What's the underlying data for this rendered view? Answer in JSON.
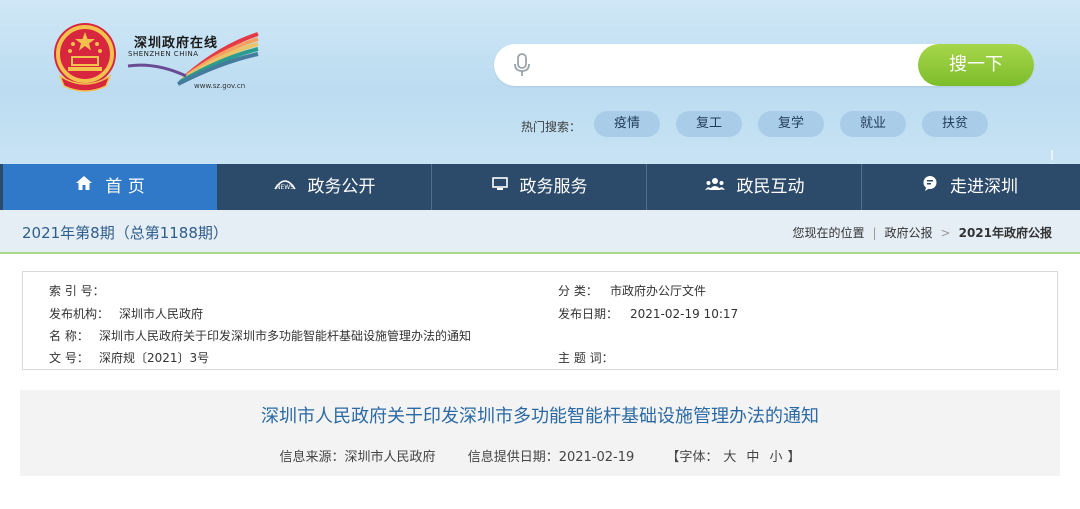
{
  "header": {
    "logo_cn": "深圳政府在线",
    "logo_en": "SHENZHEN CHINA",
    "logo_url": "www.sz.gov.cn",
    "emblem": "national-emblem",
    "search": {
      "placeholder": "",
      "button_label": "搜一下",
      "mic_icon": "microphone-icon"
    },
    "hot_search": {
      "label": "热门搜索：",
      "tags": [
        "疫情",
        "复工",
        "复学",
        "就业",
        "扶贫"
      ]
    }
  },
  "nav": {
    "items": [
      {
        "label": "首 页",
        "icon": "home-icon",
        "glyph": "⌂"
      },
      {
        "label": "政务公开",
        "icon": "news-icon",
        "glyph": "◔"
      },
      {
        "label": "政务服务",
        "icon": "monitor-icon",
        "glyph": "▣"
      },
      {
        "label": "政民互动",
        "icon": "people-icon",
        "glyph": "●●●"
      },
      {
        "label": "走进深圳",
        "icon": "chat-bubble-icon",
        "glyph": "●"
      }
    ],
    "active_index": 0
  },
  "issue": {
    "title": "2021年第8期（总第1188期）",
    "breadcrumb_label": "您现在的位置",
    "breadcrumb": [
      "政府公报",
      "2021年政府公报"
    ]
  },
  "meta": {
    "index_no_key": "索 引 号：",
    "index_no_val": "",
    "issuer_key": "发布机构：",
    "issuer_val": "深圳市人民政府",
    "name_key": "名    称：",
    "name_val": "深圳市人民政府关于印发深圳市多功能智能杆基础设施管理办法的通知",
    "doc_no_key": "文    号：",
    "doc_no_val": "深府规〔2021〕3号",
    "category_key": "分    类：",
    "category_val": "市政府办公厅文件",
    "date_key": "发布日期：",
    "date_val": "2021-02-19 10:17",
    "subject_key": "主 题 词：",
    "subject_val": ""
  },
  "article": {
    "title": "深圳市人民政府关于印发深圳市多功能智能杆基础设施管理办法的通知",
    "source": "信息来源：深圳市人民政府",
    "provided_date": "信息提供日期：2021-02-19",
    "font_label_open": "【字体：",
    "font_large": "大",
    "font_medium": "中",
    "font_small": "小",
    "font_label_close": "】"
  },
  "colors": {
    "nav_bg": "#2c4a6a",
    "nav_active": "#2f79c8",
    "search_button": "#8cc63f",
    "hot_tag": "#a9cde9",
    "title_blue": "#2b6aa5"
  }
}
